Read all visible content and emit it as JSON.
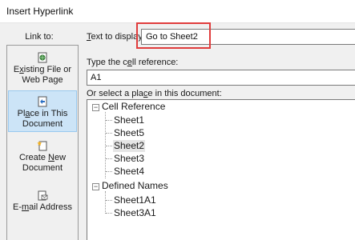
{
  "window": {
    "title": "Insert Hyperlink"
  },
  "link_to": {
    "label": "Link to:",
    "items": [
      {
        "icon": "existing-file-icon",
        "line1_pre": "E",
        "line1_u": "x",
        "line1_post": "isting File or",
        "line2": "Web Page",
        "selected": false
      },
      {
        "icon": "place-in-document-icon",
        "line1_pre": "Pl",
        "line1_u": "a",
        "line1_post": "ce in This",
        "line2": "Document",
        "selected": true
      },
      {
        "icon": "create-new-document-icon",
        "line1_pre": "Create ",
        "line1_u": "N",
        "line1_post": "ew",
        "line2": "Document",
        "selected": false
      },
      {
        "icon": "email-address-icon",
        "line1_pre": "E-",
        "line1_u": "m",
        "line1_post": "ail Address",
        "line2": "",
        "selected": false
      }
    ]
  },
  "text_to_display": {
    "label_u": "T",
    "label_rest": "ext to display:",
    "value": "Go to Sheet2"
  },
  "cell_reference": {
    "label_pre": "Type the c",
    "label_u": "e",
    "label_post": "ll reference:",
    "value": "A1"
  },
  "place_in_document": {
    "label_pre": "Or select a pla",
    "label_u": "c",
    "label_post": "e in this document:",
    "groups": [
      {
        "name": "Cell Reference",
        "expanded": true,
        "items": [
          "Sheet1",
          "Sheet5",
          "Sheet2",
          "Sheet3",
          "Sheet4"
        ],
        "selected": "Sheet2"
      },
      {
        "name": "Defined Names",
        "expanded": true,
        "items": [
          "Sheet1A1",
          "Sheet3A1"
        ],
        "selected": ""
      }
    ]
  },
  "colors": {
    "highlight_border": "#e03c3c",
    "selected_nav_bg": "#cce4f7",
    "selected_nav_border": "#99c9ef",
    "dialog_bg": "#f0f0f0"
  }
}
